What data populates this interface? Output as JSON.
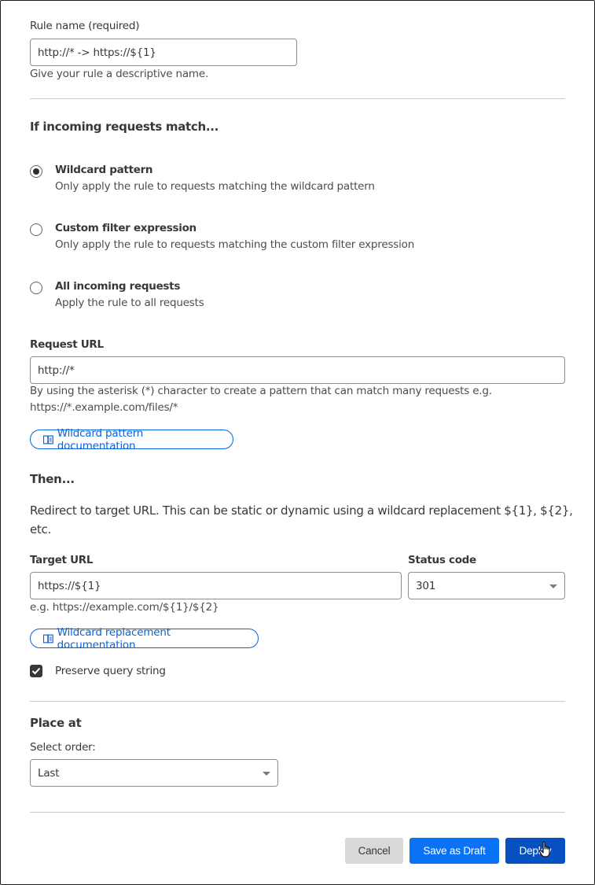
{
  "rule_name": {
    "label": "Rule name (required)",
    "value": "http://* -> https://${1}",
    "help": "Give your rule a descriptive name."
  },
  "match": {
    "title": "If incoming requests match...",
    "options": [
      {
        "title": "Wildcard pattern",
        "description": "Only apply the rule to requests matching the wildcard pattern",
        "checked": true
      },
      {
        "title": "Custom filter expression",
        "description": "Only apply the rule to requests matching the custom filter expression",
        "checked": false
      },
      {
        "title": "All incoming requests",
        "description": "Apply the rule to all requests",
        "checked": false
      }
    ]
  },
  "request_url": {
    "label": "Request URL",
    "value": "http://*",
    "help_line1": "By using the asterisk (*) character to create a pattern that can match many requests e.g.",
    "help_line2": "https://*.example.com/files/*",
    "doc_link": "Wildcard pattern documentation",
    "doc_icon": "book-icon"
  },
  "then": {
    "title": "Then...",
    "description_line1": "Redirect to target URL. This can be static or dynamic using a wildcard replacement ${1}, ${2},",
    "description_line2": "etc.",
    "target_url": {
      "label": "Target URL",
      "value": "https://${1}",
      "help": "e.g. https://example.com/${1}/${2}"
    },
    "status_code": {
      "label": "Status code",
      "value": "301"
    },
    "doc_link": "Wildcard replacement documentation",
    "doc_icon": "book-icon",
    "preserve_query": {
      "label": "Preserve query string",
      "checked": true
    }
  },
  "place_at": {
    "title": "Place at",
    "select_label": "Select order:",
    "value": "Last"
  },
  "actions": {
    "cancel": "Cancel",
    "save_draft": "Save as Draft",
    "deploy": "Deploy"
  },
  "colors": {
    "primary": "#0a73f5",
    "primary_dark": "#0750c2",
    "link": "#0a63d7",
    "cancel_bg": "#d9d9d9"
  }
}
